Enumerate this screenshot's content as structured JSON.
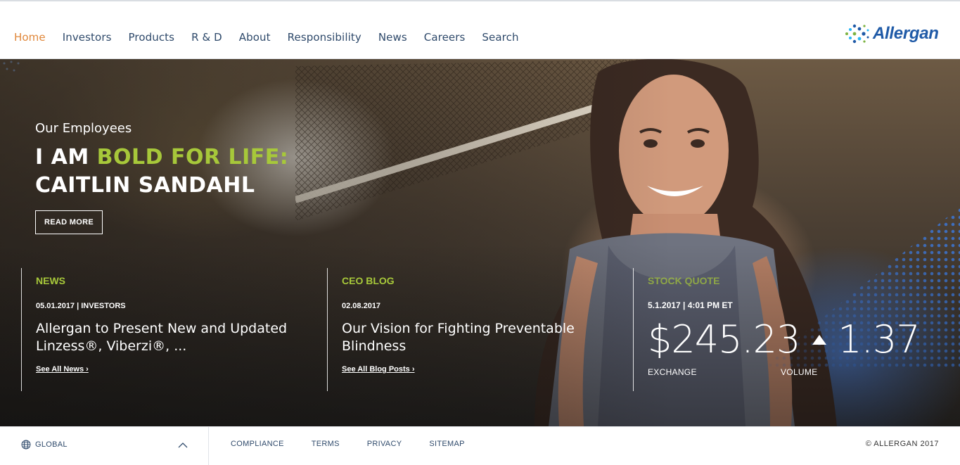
{
  "header": {
    "nav": [
      "Home",
      "Investors",
      "Products",
      "R & D",
      "About",
      "Responsibility",
      "News",
      "Careers",
      "Search"
    ],
    "logo_text": "Allergan"
  },
  "hero": {
    "eyebrow": "Our Employees",
    "headline_part1": "I AM ",
    "headline_green": "BOLD FOR LIFE:",
    "headline_line2": "CAITLIN SANDAHL",
    "read_more": "READ MORE"
  },
  "news": {
    "label": "NEWS",
    "meta": "05.01.2017 | INVESTORS",
    "title": "Allergan to Present New and Updated Linzess®, Viberzi®, ...",
    "link": "See All News ›"
  },
  "blog": {
    "label": "CEO BLOG",
    "meta": "02.08.2017",
    "title": "Our Vision for Fighting Preventable Blindness",
    "link": "See All Blog Posts ›"
  },
  "stock": {
    "label": "STOCK QUOTE",
    "meta": "5.1.2017 | 4:01 PM ET",
    "price": "$245.23",
    "change": "1.37",
    "exchange_label": "EXCHANGE",
    "volume_label": "VOLUME"
  },
  "footer": {
    "region": "GLOBAL",
    "links": [
      "COMPLIANCE",
      "TERMS",
      "PRIVACY",
      "SITEMAP"
    ],
    "copyright": "© ALLERGAN 2017"
  },
  "colors": {
    "accent_green": "#a7c83a",
    "nav_active": "#e0873a",
    "nav_text": "#2f4a6b",
    "brand_blue": "#1f5aa7"
  }
}
